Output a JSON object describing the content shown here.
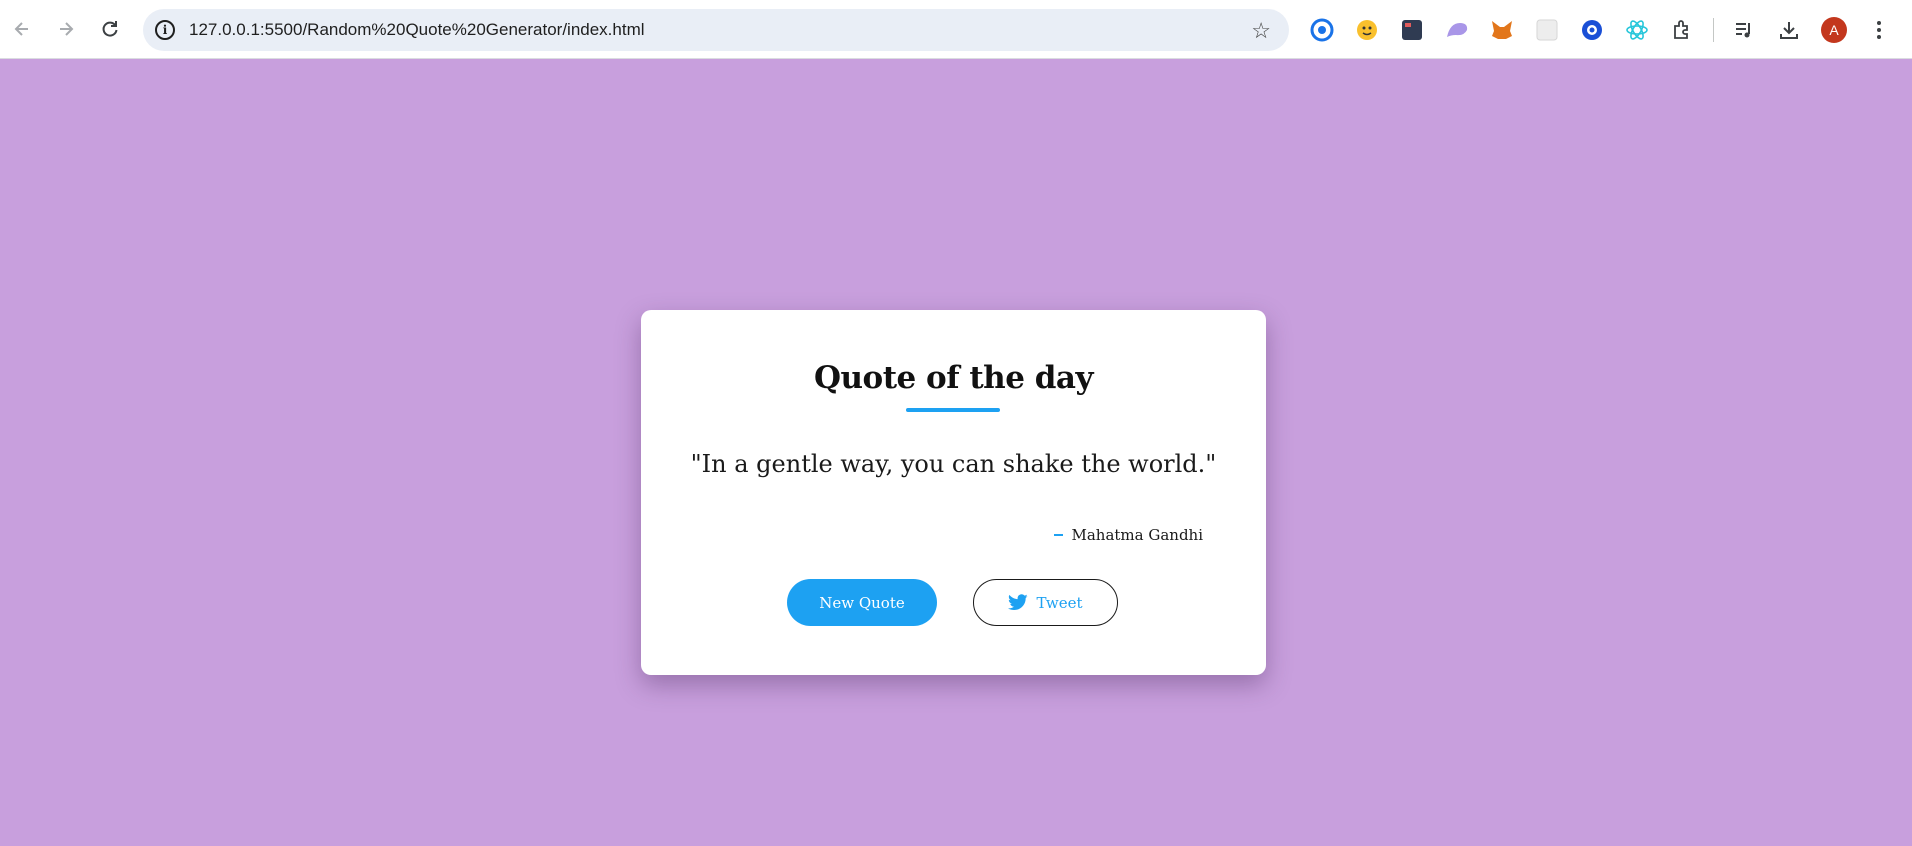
{
  "browser": {
    "url": "127.0.0.1:5500/Random%20Quote%20Generator/index.html",
    "avatar_letter": "A",
    "extensions": [
      {
        "icon": "blue-ring-icon",
        "color": "#1a73e8"
      },
      {
        "icon": "smiley-icon",
        "color": "#f4b400"
      },
      {
        "icon": "dark-app-icon",
        "color": "#2f3b52"
      },
      {
        "icon": "purple-shape-icon",
        "color": "#9b8ae0"
      },
      {
        "icon": "fox-icon",
        "color": "#e2761b"
      },
      {
        "icon": "grid-icon",
        "color": "#dddddd"
      },
      {
        "icon": "target-icon",
        "color": "#1a4fd6"
      },
      {
        "icon": "atom-icon",
        "color": "#26c6da"
      }
    ]
  },
  "card": {
    "title": "Quote of the day",
    "quote": "\"In a gentle way, you can shake the world.\"",
    "author": "Mahatma Gandhi",
    "new_quote_label": "New Quote",
    "tweet_label": "Tweet"
  },
  "colors": {
    "background": "#c89fdd",
    "accent": "#1da1f2"
  }
}
